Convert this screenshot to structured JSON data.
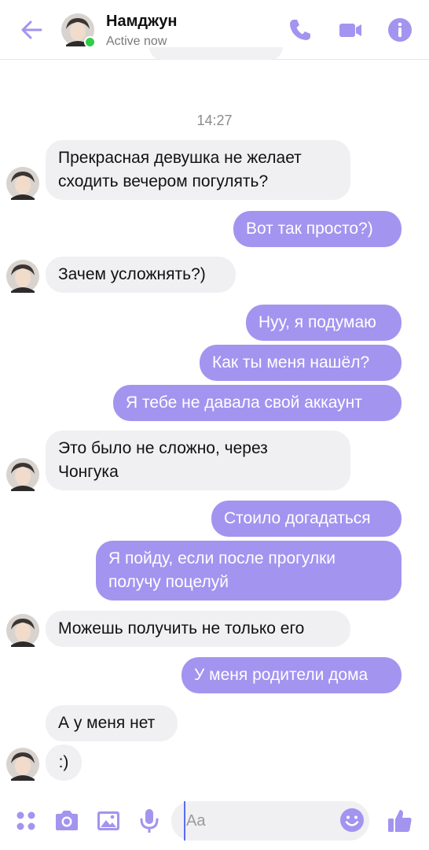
{
  "header": {
    "contact_name": "Намджун",
    "status": "Active now",
    "icons": [
      "back-arrow-icon",
      "phone-icon",
      "video-camera-icon",
      "info-icon"
    ],
    "accent_color": "#a394f0",
    "online_color": "#31cc46"
  },
  "conversation": {
    "timestamp": "14:27",
    "messages": [
      {
        "dir": "in",
        "text": "Прекрасная девушка не желает\nсходить вечером погулять?"
      },
      {
        "dir": "out",
        "text": "Вот так просто?)"
      },
      {
        "dir": "in",
        "text": "Зачем усложнять?)"
      },
      {
        "dir": "out",
        "text": "Нуу, я подумаю"
      },
      {
        "dir": "out",
        "text": "Как ты меня нашёл?"
      },
      {
        "dir": "out",
        "text": "Я тебе не давала свой аккаунт"
      },
      {
        "dir": "in",
        "text": "Это было не сложно, через\nЧонгука"
      },
      {
        "dir": "out",
        "text": "Стоило догадаться"
      },
      {
        "dir": "out",
        "text": "Я пойду, если после прогулки\nполучу поцелуй"
      },
      {
        "dir": "in",
        "text": "Можешь получить не только его"
      },
      {
        "dir": "out",
        "text": "У меня родители дома"
      },
      {
        "dir": "in",
        "text": "А у меня нет"
      },
      {
        "dir": "in",
        "text": ":)"
      }
    ],
    "incoming_bubble_color": "#f0f0f2",
    "outgoing_bubble_color": "#a394f0"
  },
  "composer": {
    "placeholder": "Aa",
    "icons": [
      "more-dots-icon",
      "camera-icon",
      "image-icon",
      "microphone-icon",
      "emoji-icon",
      "thumbs-up-icon"
    ]
  }
}
